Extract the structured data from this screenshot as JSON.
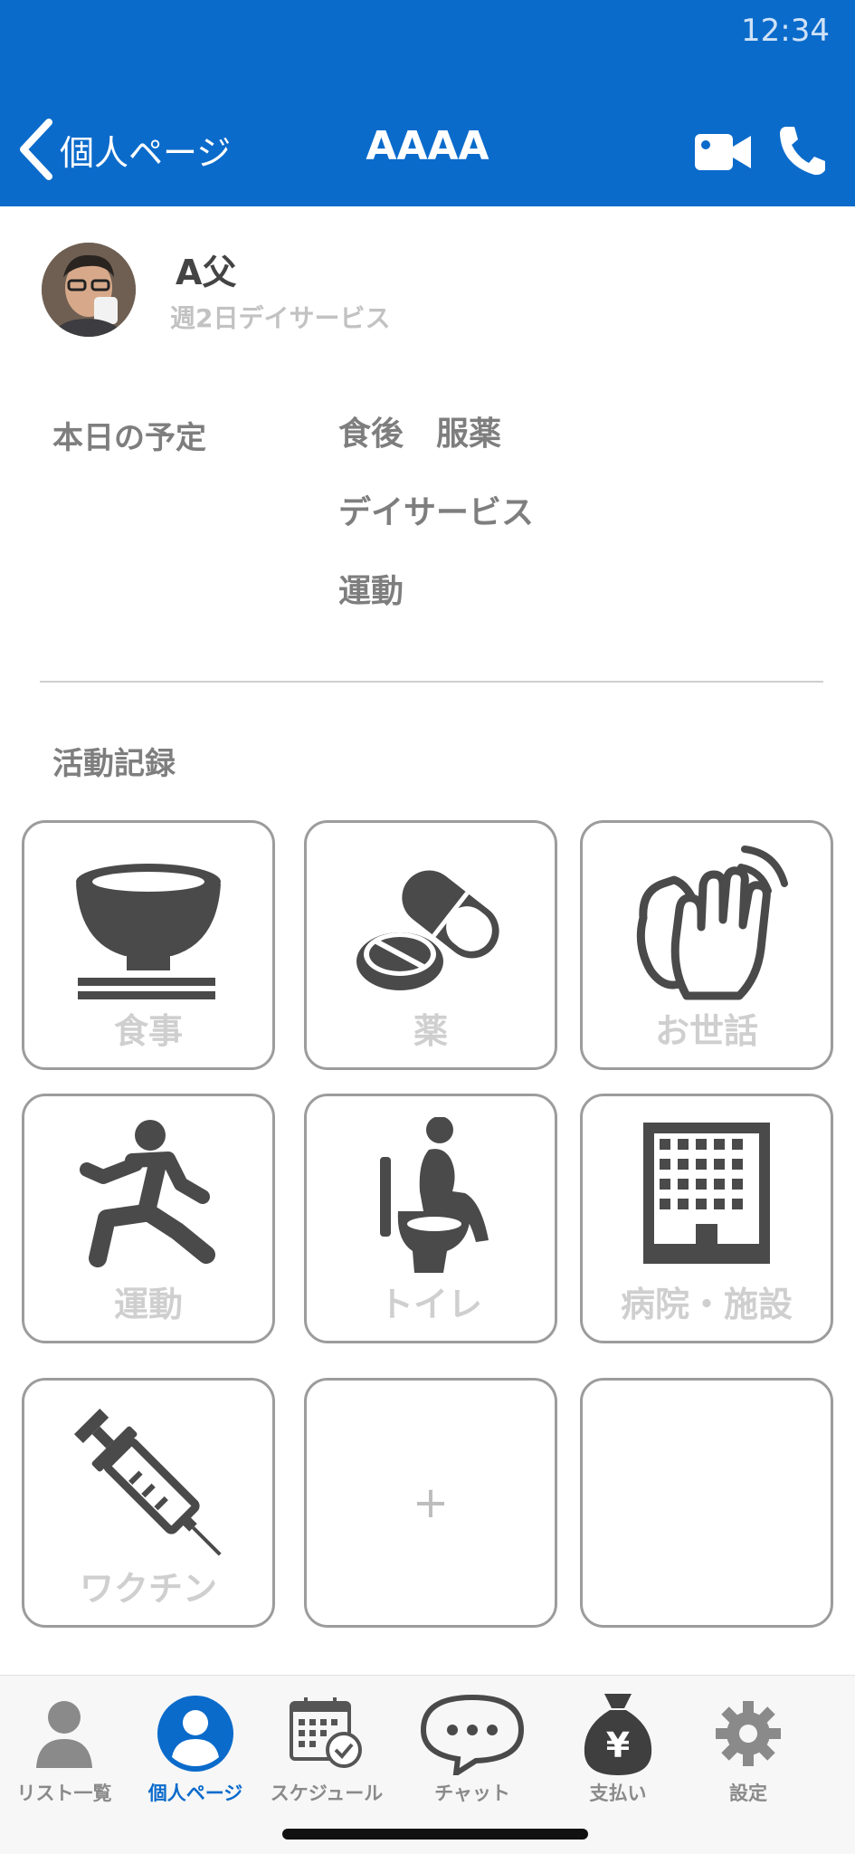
{
  "status": {
    "time": "12:34"
  },
  "header": {
    "back_label": "個人ページ",
    "title": "AAAA",
    "video_icon": "video-camera-icon",
    "phone_icon": "phone-icon"
  },
  "profile": {
    "name": "A父",
    "subtitle": "週2日デイサービス"
  },
  "schedule": {
    "label": "本日の予定",
    "items": [
      "食後　服薬",
      "デイサービス",
      "運動"
    ]
  },
  "activity": {
    "label": "活動記録",
    "tiles": [
      {
        "label": "食事",
        "icon": "rice-bowl-icon"
      },
      {
        "label": "薬",
        "icon": "pills-icon"
      },
      {
        "label": "お世話",
        "icon": "clapping-hands-icon"
      },
      {
        "label": "運動",
        "icon": "running-person-icon"
      },
      {
        "label": "トイレ",
        "icon": "toilet-icon"
      },
      {
        "label": "病院・施設",
        "icon": "building-icon"
      },
      {
        "label": "ワクチン",
        "icon": "syringe-icon"
      },
      {
        "label": "+",
        "icon": "plus-icon"
      },
      {
        "label": "",
        "icon": ""
      }
    ]
  },
  "tabbar": {
    "items": [
      {
        "label": "リスト一覧",
        "icon": "person-icon",
        "active": false
      },
      {
        "label": "個人ページ",
        "icon": "profile-circle-icon",
        "active": true
      },
      {
        "label": "スケジュール",
        "icon": "calendar-check-icon",
        "active": false
      },
      {
        "label": "チャット",
        "icon": "chat-bubble-icon",
        "active": false
      },
      {
        "label": "支払い",
        "icon": "money-bag-icon",
        "active": false
      },
      {
        "label": "設定",
        "icon": "gear-icon",
        "active": false
      }
    ]
  },
  "colors": {
    "brand": "#0b6bcb",
    "icon": "#4a4a4a",
    "tile_border": "#9c9c9c",
    "muted_text": "#7e7e7e"
  }
}
